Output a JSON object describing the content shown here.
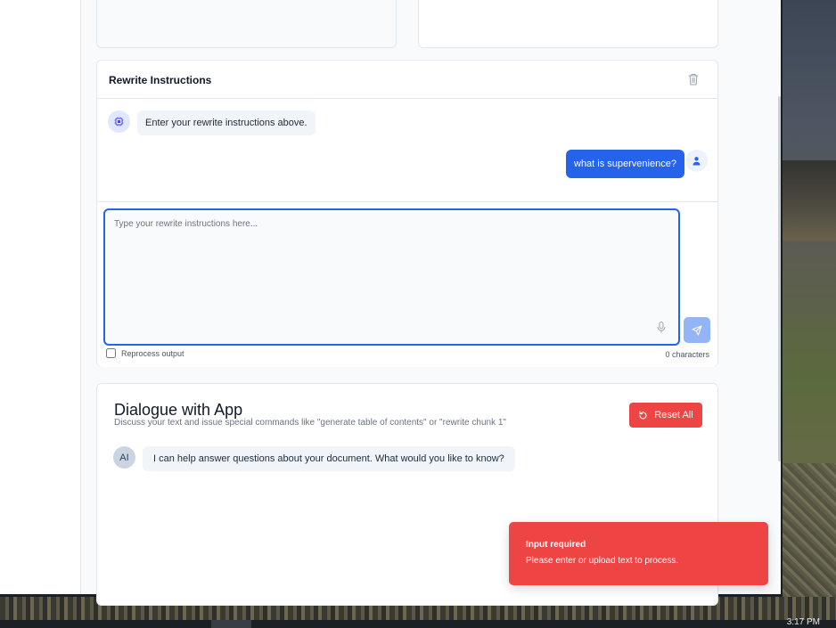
{
  "rewrite_panel": {
    "title": "Rewrite Instructions",
    "messages": [
      {
        "role": "bot",
        "text": "Enter your rewrite instructions above."
      },
      {
        "role": "user",
        "text": "what is supervenience?"
      }
    ],
    "input": {
      "placeholder": "Type your rewrite instructions here...",
      "value": ""
    },
    "reprocess_label": "Reprocess output",
    "reprocess_checked": false,
    "char_count": "0 characters"
  },
  "dialogue_panel": {
    "title": "Dialogue with App",
    "subtitle": "Discuss your text and issue special commands like \"generate table of contents\" or \"rewrite chunk 1\"",
    "reset_label": "Reset All",
    "avatar_label": "AI",
    "messages": [
      {
        "role": "ai",
        "text": "I can help answer questions about your document. What would you like to know?"
      }
    ]
  },
  "toast": {
    "title": "Input required",
    "body": "Please enter or upload text to process."
  },
  "taskbar": {
    "clock": "3:17 PM"
  },
  "colors": {
    "primary": "#2563eb",
    "danger": "#ef4444",
    "send_disabled": "#93b4f5"
  }
}
